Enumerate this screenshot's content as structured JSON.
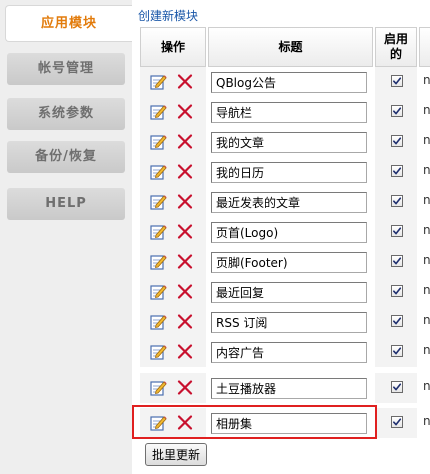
{
  "sidebar": {
    "active": "应用模块",
    "items": [
      "帐号管理",
      "系统参数",
      "备份/恢复",
      "HELP"
    ]
  },
  "main": {
    "create_link": "创建新模块",
    "headers": {
      "ops": "操作",
      "title": "标题",
      "enabled_line1": "启用",
      "enabled_line2": "的"
    },
    "row_extra": "n",
    "rows": [
      {
        "title": "QBlog公告",
        "enabled": true
      },
      {
        "title": "导航栏",
        "enabled": true
      },
      {
        "title": "我的文章",
        "enabled": true
      },
      {
        "title": "我的日历",
        "enabled": true
      },
      {
        "title": "最近发表的文章",
        "enabled": true
      },
      {
        "title": "页首(Logo)",
        "enabled": true
      },
      {
        "title": "页脚(Footer)",
        "enabled": true
      },
      {
        "title": "最近回复",
        "enabled": true
      },
      {
        "title": "RSS 订阅",
        "enabled": true
      },
      {
        "title": "内容广告",
        "enabled": true
      },
      {
        "title": "土豆播放器",
        "enabled": true
      },
      {
        "title": "相册集",
        "enabled": true
      }
    ],
    "batch_button": "批里更新"
  },
  "icons": {
    "edit": "edit-icon",
    "delete": "delete-icon",
    "check": "check-icon"
  },
  "colors": {
    "active_tab_text": "#e27b0b",
    "link": "#1a57a8",
    "delete": "#c8102e",
    "highlight": "#e02020"
  }
}
